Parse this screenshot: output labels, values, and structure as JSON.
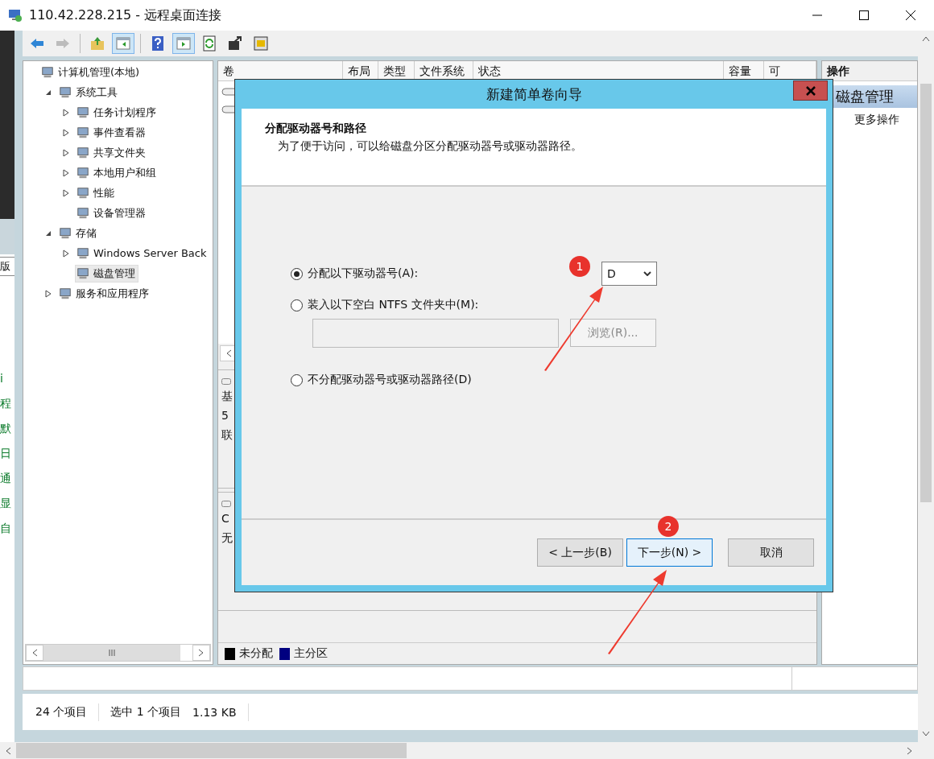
{
  "window": {
    "title": "110.42.228.215 - 远程桌面连接"
  },
  "background_window": {
    "field_text": "版",
    "links": [
      "i",
      "程",
      "默",
      "日",
      "通",
      "显",
      "自"
    ]
  },
  "toolbar": [
    {
      "kind": "back",
      "disabled": false,
      "pressed": false
    },
    {
      "kind": "forward",
      "disabled": true,
      "pressed": false
    },
    {
      "kind": "up",
      "disabled": false,
      "pressed": false
    },
    {
      "kind": "tree",
      "disabled": false,
      "pressed": true
    },
    {
      "kind": "help",
      "disabled": false,
      "pressed": false
    },
    {
      "kind": "action",
      "disabled": false,
      "pressed": true
    },
    {
      "kind": "refresh",
      "disabled": false,
      "pressed": false
    },
    {
      "kind": "export",
      "disabled": false,
      "pressed": false
    },
    {
      "kind": "properties",
      "disabled": false,
      "pressed": false
    }
  ],
  "tree": [
    {
      "label": "计算机管理(本地)",
      "selected": false,
      "children": [
        {
          "label": "系统工具",
          "expanded": true,
          "selected": false,
          "children": [
            {
              "label": "任务计划程序",
              "expanded": false,
              "selected": false
            },
            {
              "label": "事件查看器",
              "expanded": false,
              "selected": false
            },
            {
              "label": "共享文件夹",
              "expanded": false,
              "selected": false
            },
            {
              "label": "本地用户和组",
              "expanded": false,
              "selected": false
            },
            {
              "label": "性能",
              "expanded": false,
              "selected": false
            },
            {
              "label": "设备管理器",
              "selected": false
            }
          ]
        },
        {
          "label": "存储",
          "expanded": true,
          "selected": false,
          "children": [
            {
              "label": "Windows Server Back",
              "expanded": false,
              "selected": false
            },
            {
              "label": "磁盘管理",
              "selected": true
            }
          ]
        },
        {
          "label": "服务和应用程序",
          "expanded": false,
          "selected": false
        }
      ]
    }
  ],
  "table": {
    "columns": [
      "卷",
      "布局",
      "类型",
      "文件系统",
      "状态",
      "容量",
      "可"
    ]
  },
  "disks": [
    {
      "lines": [
        "基",
        "5",
        "联"
      ]
    },
    {
      "lines": [
        "C",
        "无"
      ]
    }
  ],
  "legend": [
    {
      "label": "未分配",
      "color": "#000000"
    },
    {
      "label": "主分区",
      "color": "#000080"
    }
  ],
  "actions": {
    "header": "操作",
    "items": [
      {
        "kind": "section",
        "label": "磁盘管理"
      },
      {
        "kind": "link",
        "label": "更多操作"
      }
    ]
  },
  "status_bar": [
    "24 个项目",
    "选中 1 个项目",
    "1.13 KB"
  ],
  "dialog": {
    "title": "新建简单卷向导",
    "heading": "分配驱动器号和路径",
    "subheading": "为了便于访问，可以给磁盘分区分配驱动器号或驱动器路径。",
    "options": [
      {
        "label": "分配以下驱动器号(A):",
        "selected": true
      },
      {
        "label": "装入以下空白 NTFS 文件夹中(M):",
        "selected": false
      },
      {
        "label": "不分配驱动器号或驱动器路径(D)",
        "selected": false
      }
    ],
    "drive_letter": "D",
    "folder_field": {
      "disabled": true
    },
    "browse": {
      "label": "浏览(R)...",
      "disabled": true
    },
    "buttons": [
      {
        "label": "< 上一步(B)",
        "default": false
      },
      {
        "label": "下一步(N) >",
        "default": true
      },
      {
        "label": "取消",
        "default": false
      }
    ]
  },
  "annotations": [
    {
      "label": "1"
    },
    {
      "label": "2"
    }
  ]
}
